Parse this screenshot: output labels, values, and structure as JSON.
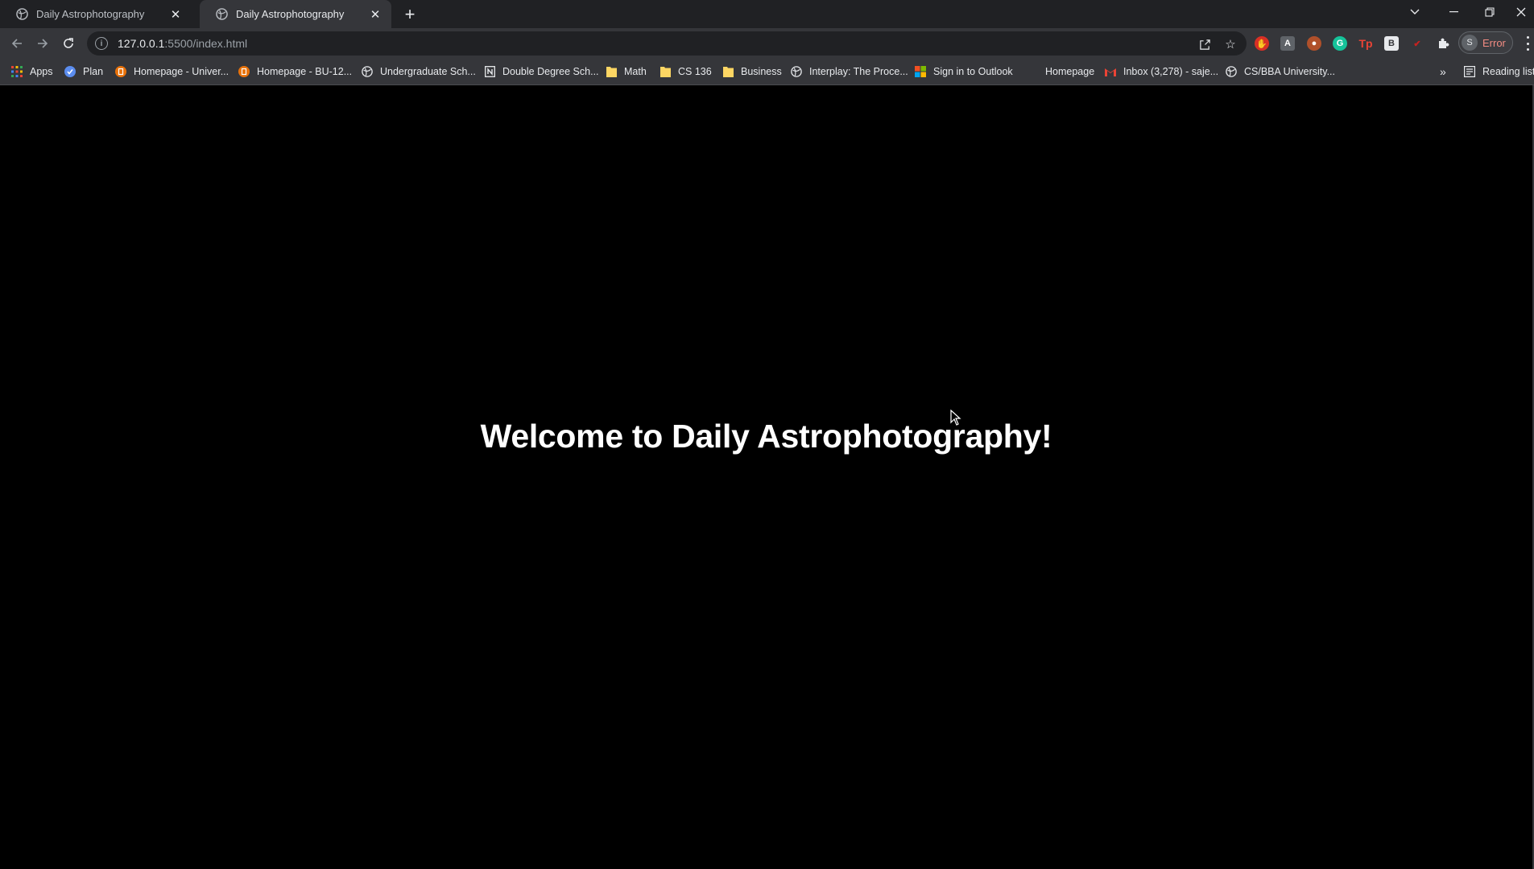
{
  "tabs": [
    {
      "title": "Daily Astrophotography",
      "active": false
    },
    {
      "title": "Daily Astrophotography",
      "active": true
    }
  ],
  "address": {
    "host": "127.0.0.1",
    "path": ":5500/index.html"
  },
  "profile": {
    "initial": "S",
    "status": "Error"
  },
  "bookmarks": [
    {
      "label": "Apps",
      "icon": "apps-grid-icon"
    },
    {
      "label": "Plan",
      "icon": "plan-check-icon"
    },
    {
      "label": "Homepage - Univer...",
      "icon": "university-icon"
    },
    {
      "label": "Homepage - BU-12...",
      "icon": "university-icon"
    },
    {
      "label": "Undergraduate Sch...",
      "icon": "globe-icon"
    },
    {
      "label": "Double Degree Sch...",
      "icon": "notion-icon"
    },
    {
      "label": "Math",
      "icon": "folder-icon"
    },
    {
      "label": "CS 136",
      "icon": "folder-icon"
    },
    {
      "label": "Business",
      "icon": "folder-icon"
    },
    {
      "label": "Interplay: The Proce...",
      "icon": "globe-icon"
    },
    {
      "label": "Sign in to Outlook",
      "icon": "microsoft-icon"
    },
    {
      "label": "Homepage",
      "icon": ""
    },
    {
      "label": "Inbox (3,278) - saje...",
      "icon": "gmail-icon"
    },
    {
      "label": "CS/BBA University...",
      "icon": "globe-icon"
    }
  ],
  "reading_list": "Reading list",
  "page": {
    "heading": "Welcome to Daily Astrophotography!"
  }
}
